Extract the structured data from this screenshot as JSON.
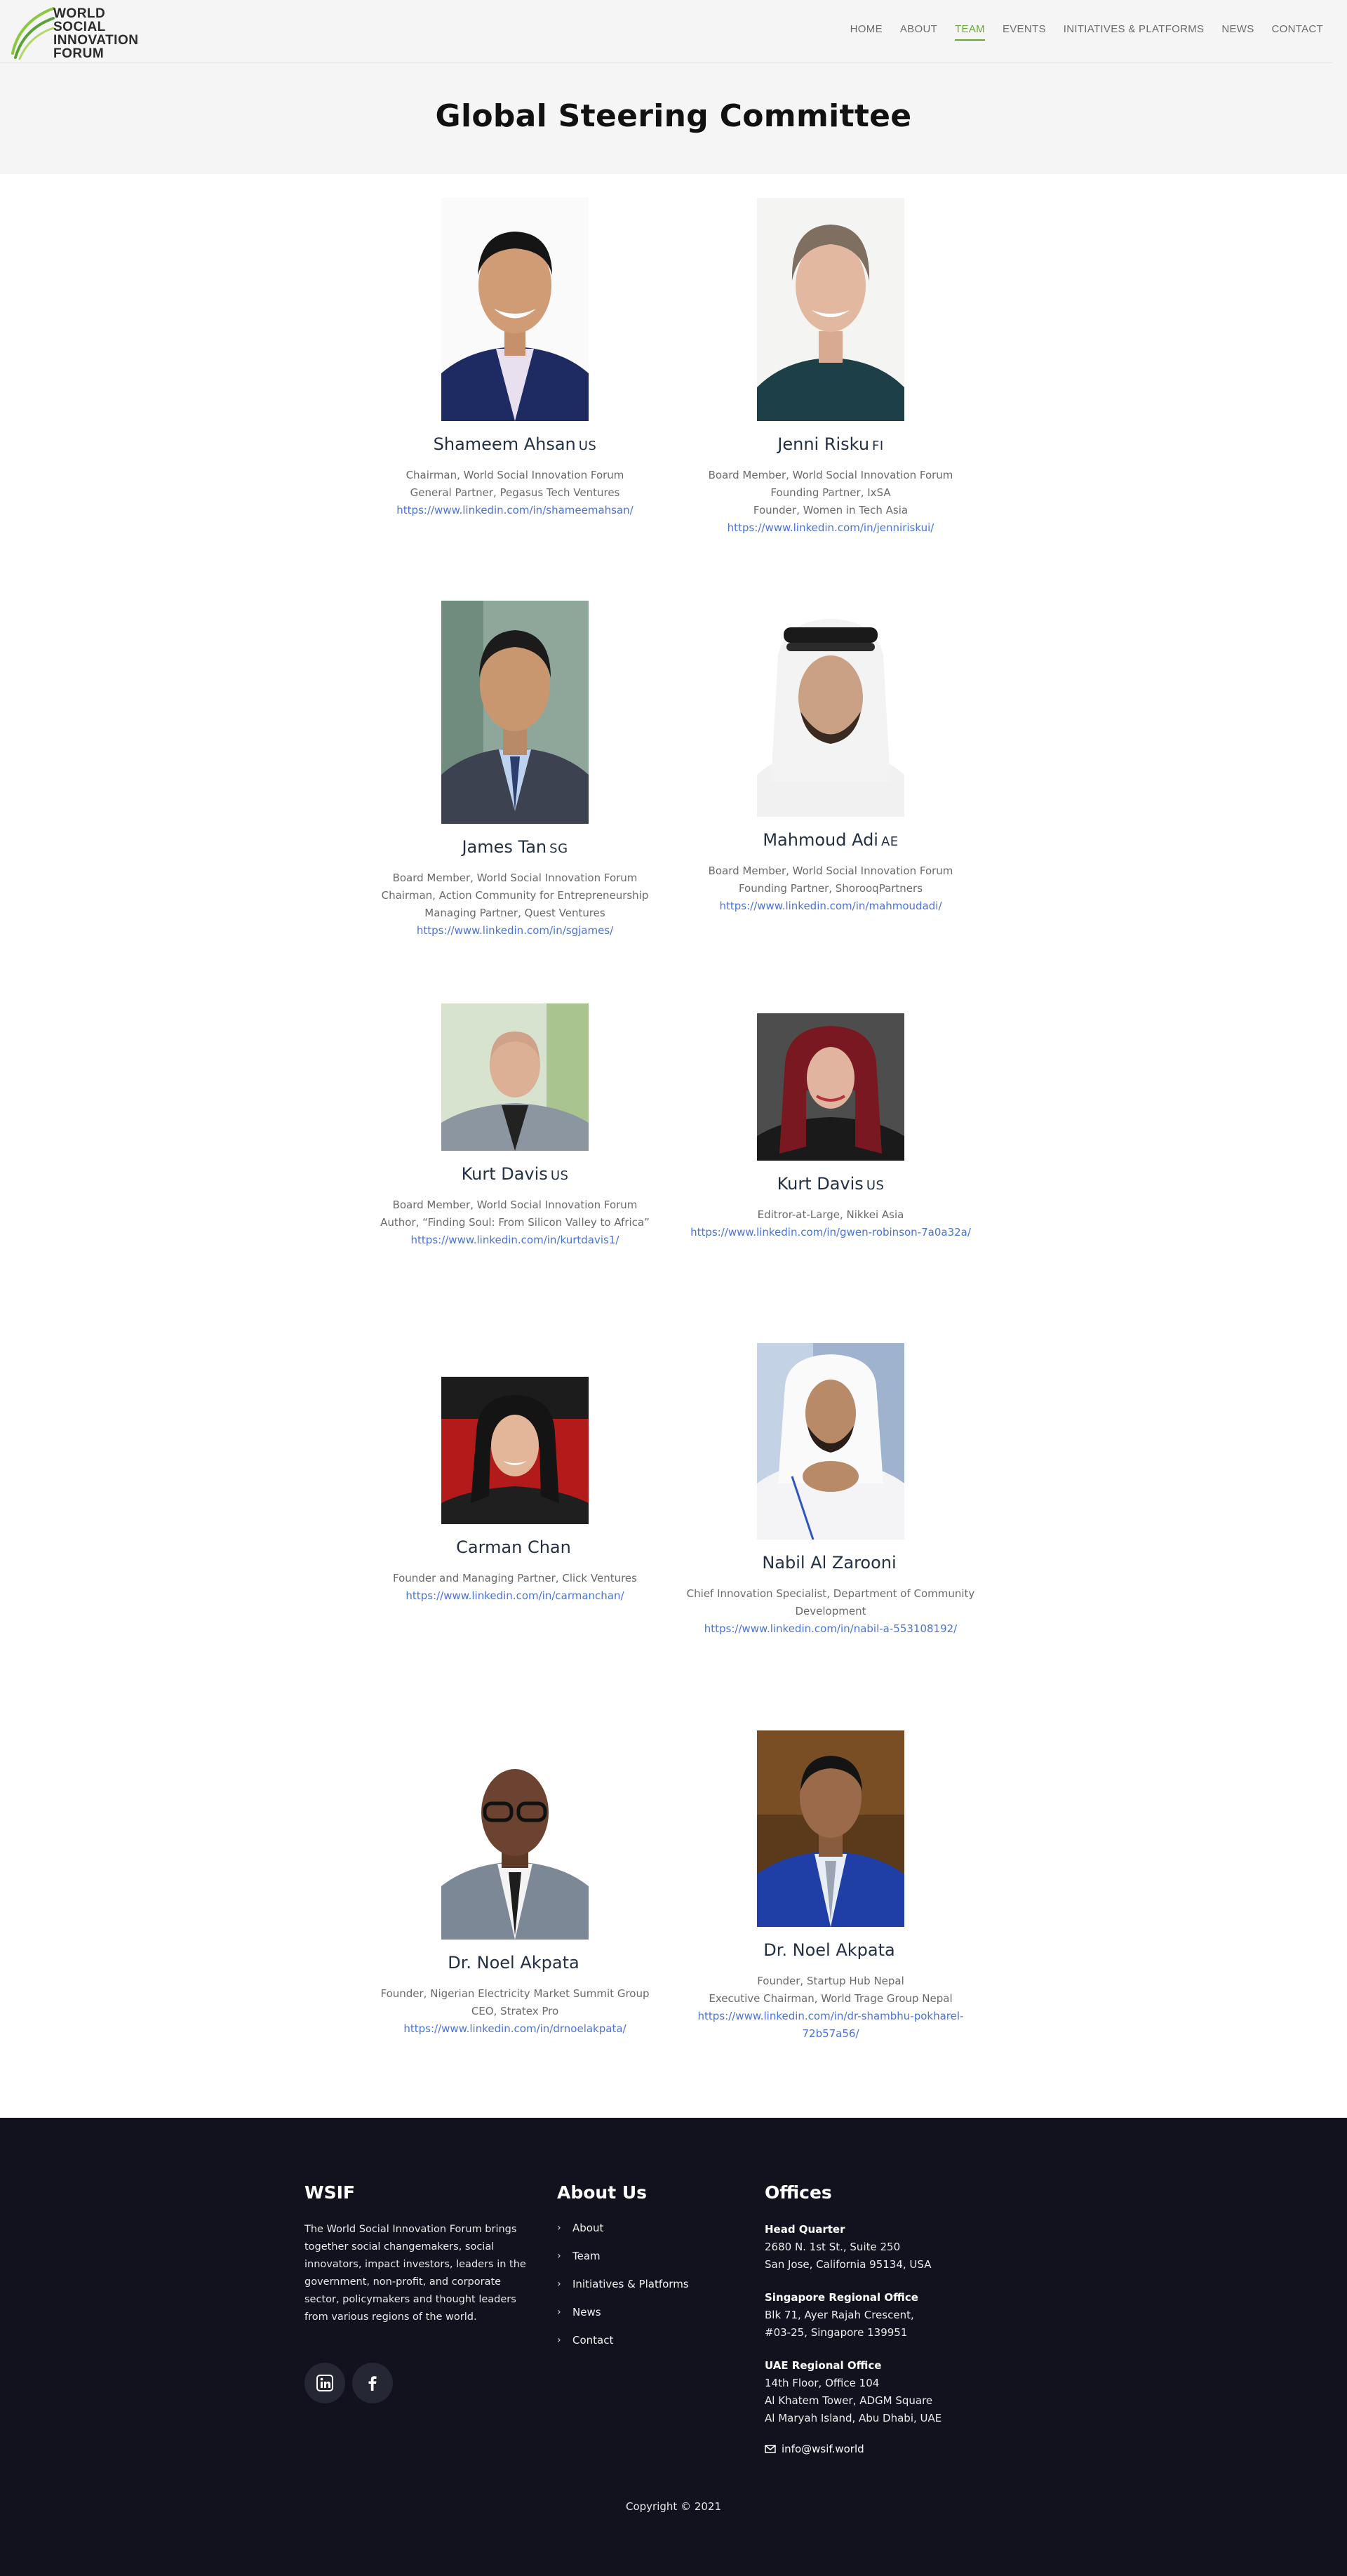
{
  "brand": {
    "logo_lines": [
      "WORLD",
      "SOCIAL",
      "INNOVATION",
      "FORUM"
    ]
  },
  "nav": {
    "items": [
      "HOME",
      "ABOUT",
      "TEAM",
      "EVENTS",
      "INITIATIVES & PLATFORMS",
      "NEWS",
      "CONTACT"
    ],
    "active": "TEAM"
  },
  "page": {
    "title": "Global Steering Committee"
  },
  "members": [
    {
      "name": "Shameem Ahsan",
      "country": "US",
      "roles": [
        "Chairman, World Social Innovation Forum",
        "General Partner, Pegasus Tech Ventures"
      ],
      "link": "https://www.linkedin.com/in/shameemahsan/"
    },
    {
      "name": "Jenni Risku",
      "country": "FI",
      "roles": [
        "Board Member, World Social Innovation Forum",
        "Founding Partner, IxSA",
        "Founder, Women in Tech Asia"
      ],
      "link": "https://www.linkedin.com/in/jenniriskui/"
    },
    {
      "name": "James Tan",
      "country": "SG",
      "roles": [
        "Board Member, World Social Innovation Forum",
        "Chairman, Action Community for Entrepreneurship",
        "Managing Partner, Quest Ventures"
      ],
      "link": "https://www.linkedin.com/in/sgjames/"
    },
    {
      "name": "Mahmoud Adi",
      "country": "AE",
      "roles": [
        "Board Member, World Social Innovation Forum",
        "Founding Partner, ShorooqPartners"
      ],
      "link": "https://www.linkedin.com/in/mahmoudadi/"
    },
    {
      "name": "Kurt Davis",
      "country": "US",
      "roles": [
        "Board Member, World Social Innovation Forum",
        "Author, “Finding Soul: From Silicon Valley to Africa”"
      ],
      "link": "https://www.linkedin.com/in/kurtdavis1/"
    },
    {
      "name": "Kurt Davis",
      "country": "US",
      "roles": [
        "Editror-at-Large, Nikkei Asia"
      ],
      "link": "https://www.linkedin.com/in/gwen-robinson-7a0a32a/"
    },
    {
      "name": "Carman Chan",
      "country": "",
      "roles": [
        "Founder and Managing Partner, Click Ventures"
      ],
      "link": "https://www.linkedin.com/in/carmanchan/"
    },
    {
      "name": "Nabil Al Zarooni",
      "country": "",
      "roles": [
        "Chief Innovation Specialist, Department of Community",
        "Development"
      ],
      "link": "https://www.linkedin.com/in/nabil-a-553108192/"
    },
    {
      "name": "Dr. Noel Akpata",
      "country": "",
      "roles": [
        "Founder, Nigerian Electricity Market Summit Group",
        "CEO, Stratex Pro"
      ],
      "link": "https://www.linkedin.com/in/drnoelakpata/"
    },
    {
      "name": "Dr. Noel Akpata",
      "country": "",
      "roles": [
        "Founder, Startup Hub Nepal",
        "Executive Chairman, World Trage Group Nepal"
      ],
      "link_lines": [
        "https://www.linkedin.com/in/dr-shambhu-pokharel-",
        "72b57a56/"
      ]
    }
  ],
  "footer": {
    "brand": "WSIF",
    "about_text": "The World Social Innovation Forum brings together social changemakers, social innovators, impact investors, leaders in the government, non-profit, and corporate sector, policymakers and thought leaders from various regions of the world.",
    "social": [
      "linkedin-icon",
      "facebook-icon"
    ],
    "about_title": "About Us",
    "links": [
      "About",
      "Team",
      "Initiatives & Platforms",
      "News",
      "Contact"
    ],
    "offices_title": "Offices",
    "offices": [
      {
        "title": "Head Quarter",
        "lines": [
          "2680 N. 1st St., Suite 250",
          "San Jose, California 95134, USA"
        ]
      },
      {
        "title": "Singapore Regional Office",
        "lines": [
          "Blk 71, Ayer Rajah Crescent,",
          "#03-25, Singapore 139951"
        ]
      },
      {
        "title": "UAE Regional Office",
        "lines": [
          "14th Floor, Office 104",
          "Al Khatem Tower, ADGM Square",
          "Al Maryah Island, Abu Dhabi, UAE"
        ]
      }
    ],
    "email": "info@wsif.world",
    "copyright": "Copyright © 2021"
  },
  "colors": {
    "accent": "#6aa33c",
    "link": "#4a73d6",
    "name": "#233044",
    "footer_bg": "#11121e"
  }
}
